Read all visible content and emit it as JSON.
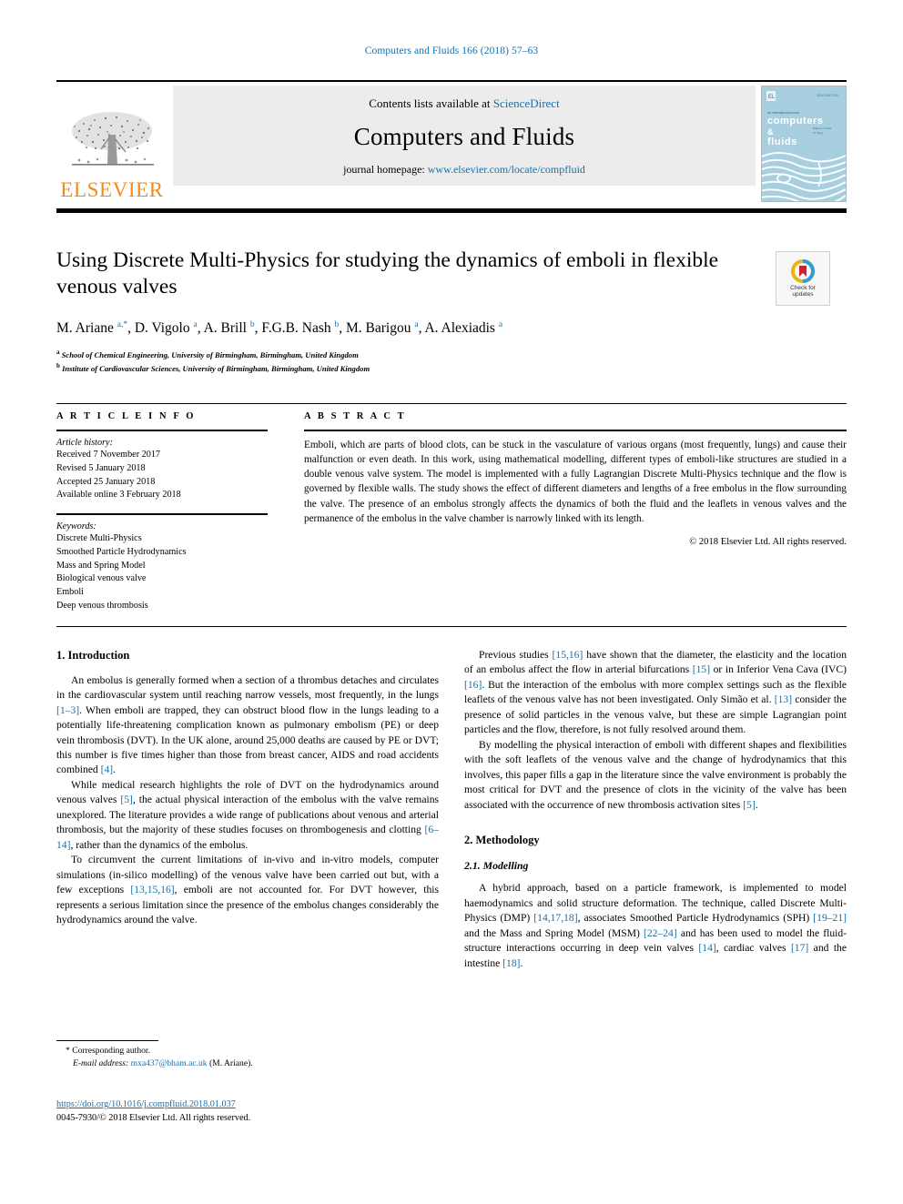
{
  "running_head": "Computers and Fluids 166 (2018) 57–63",
  "masthead": {
    "publisher": "ELSEVIER",
    "contents_prefix": "Contents lists available at ",
    "contents_link": "ScienceDirect",
    "journal_title": "Computers and Fluids",
    "homepage_prefix": "journal homepage: ",
    "homepage_link": "www.elsevier.com/locate/compfluid",
    "cover_title_line1": "computers",
    "cover_title_line2": "&",
    "cover_title_line3": "fluids",
    "cover_kicker": "An international journal"
  },
  "article": {
    "title": "Using Discrete Multi-Physics for studying the dynamics of emboli in flexible venous valves",
    "crossmark_label_line1": "Check for",
    "crossmark_label_line2": "updates",
    "authors_html": "M. Ariane <sup class=\"star\">a,*</sup>, D. Vigolo <sup>a</sup>, A. Brill <sup>b</sup>, F.G.B. Nash <sup>b</sup>, M. Barigou <sup>a</sup>, A. Alexiadis <sup>a</sup>",
    "affiliation_a": "School of Chemical Engineering, University of Birmingham, Birmingham, United Kingdom",
    "affiliation_b": "Institute of Cardiovascular Sciences, University of Birmingham, Birmingham, United Kingdom"
  },
  "info": {
    "heading": "A R T I C L E   I N F O",
    "history_label": "Article history:",
    "history": [
      "Received 7 November 2017",
      "Revised 5 January 2018",
      "Accepted 25 January 2018",
      "Available online 3 February 2018"
    ],
    "keywords_label": "Keywords:",
    "keywords": [
      "Discrete Multi-Physics",
      "Smoothed Particle Hydrodynamics",
      "Mass and Spring Model",
      "Biological venous valve",
      "Emboli",
      "Deep venous thrombosis"
    ]
  },
  "abstract": {
    "heading": "A B S T R A C T",
    "text": "Emboli, which are parts of blood clots, can be stuck in the vasculature of various organs (most frequently, lungs) and cause their malfunction or even death. In this work, using mathematical modelling, different types of emboli-like structures are studied in a double venous valve system. The model is implemented with a fully Lagrangian Discrete Multi-Physics technique and the flow is governed by flexible walls. The study shows the effect of different diameters and lengths of a free embolus in the flow surrounding the valve. The presence of an embolus strongly affects the dynamics of both the fluid and the leaflets in venous valves and the permanence of the embolus in the valve chamber is narrowly linked with its length.",
    "copyright": "© 2018 Elsevier Ltd. All rights reserved."
  },
  "body": {
    "left": {
      "section_heading": "1. Introduction",
      "paragraphs_html": [
        "An embolus is generally formed when a section of a thrombus detaches and circulates in the cardiovascular system until reaching narrow vessels, most frequently, in the lungs <span class=\"ref\">[1–3]</span>. When emboli are trapped, they can obstruct blood flow in the lungs leading to a potentially life-threatening complication known as pulmonary embolism (PE) or deep vein thrombosis (DVT). In the UK alone, around 25,000 deaths are caused by PE or DVT; this number is five times higher than those from breast cancer, AIDS and road accidents combined <span class=\"ref\">[4]</span>.",
        "While medical research highlights the role of DVT on the hydrodynamics around venous valves <span class=\"ref\">[5]</span>, the actual physical interaction of the embolus with the valve remains unexplored. The literature provides a wide range of publications about venous and arterial thrombosis, but the majority of these studies focuses on thrombogenesis and clotting <span class=\"ref\">[6–14]</span>, rather than the dynamics of the embolus.",
        "To circumvent the current limitations of in-vivo and in-vitro models, computer simulations (in-silico modelling) of the venous valve have been carried out but, with a few exceptions <span class=\"ref\">[13,15,16]</span>, emboli are not accounted for. For DVT however, this represents a serious limitation since the presence of the embolus changes considerably the hydrodynamics around the valve."
      ]
    },
    "right": {
      "paragraphs_html": [
        "Previous studies <span class=\"ref\">[15,16]</span> have shown that the diameter, the elasticity and the location of an embolus affect the flow in arterial bifurcations <span class=\"ref\">[15]</span> or in Inferior Vena Cava (IVC) <span class=\"ref\">[16]</span>. But the interaction of the embolus with more complex settings such as the flexible leaflets of the venous valve has not been investigated. Only Simão et al. <span class=\"ref\">[13]</span> consider the presence of solid particles in the venous valve, but these are simple Lagrangian point particles and the flow, therefore, is not fully resolved around them.",
        "By modelling the physical interaction of emboli with different shapes and flexibilities with the soft leaflets of the venous valve and the change of hydrodynamics that this involves, this paper fills a gap in the literature since the valve environment is probably the most critical for DVT and the presence of clots in the vicinity of the valve has been associated with the occurrence of new thrombosis activation sites <span class=\"ref\">[5]</span>."
      ],
      "section_heading": "2. Methodology",
      "subsection_heading": "2.1. Modelling",
      "subsection_paragraphs_html": [
        "A hybrid approach, based on a particle framework, is implemented to model haemodynamics and solid structure deformation. The technique, called Discrete Multi-Physics (DMP) <span class=\"ref\">[14,17,18]</span>, associates Smoothed Particle Hydrodynamics (SPH) <span class=\"ref\">[19–21]</span> and the Mass and Spring Model (MSM) <span class=\"ref\">[22–24]</span> and has been used to model the fluid-structure interactions occurring in deep vein valves <span class=\"ref\">[14]</span>, cardiac valves <span class=\"ref\">[17]</span> and the intestine <span class=\"ref\">[18]</span>."
      ]
    }
  },
  "footnote": {
    "corresponding": "* Corresponding author.",
    "email_label": "E-mail address:",
    "email": "mxa437@bham.ac.uk",
    "email_owner": "(M. Ariane).",
    "doi": "https://doi.org/10.1016/j.compfluid.2018.01.037",
    "issn_line": "0045-7930/© 2018 Elsevier Ltd. All rights reserved."
  },
  "colors": {
    "link": "#1a6fa8",
    "elsevier_orange": "#f08c1b",
    "cover_blue": "#a8cfe0",
    "band_grey": "#ececec"
  }
}
